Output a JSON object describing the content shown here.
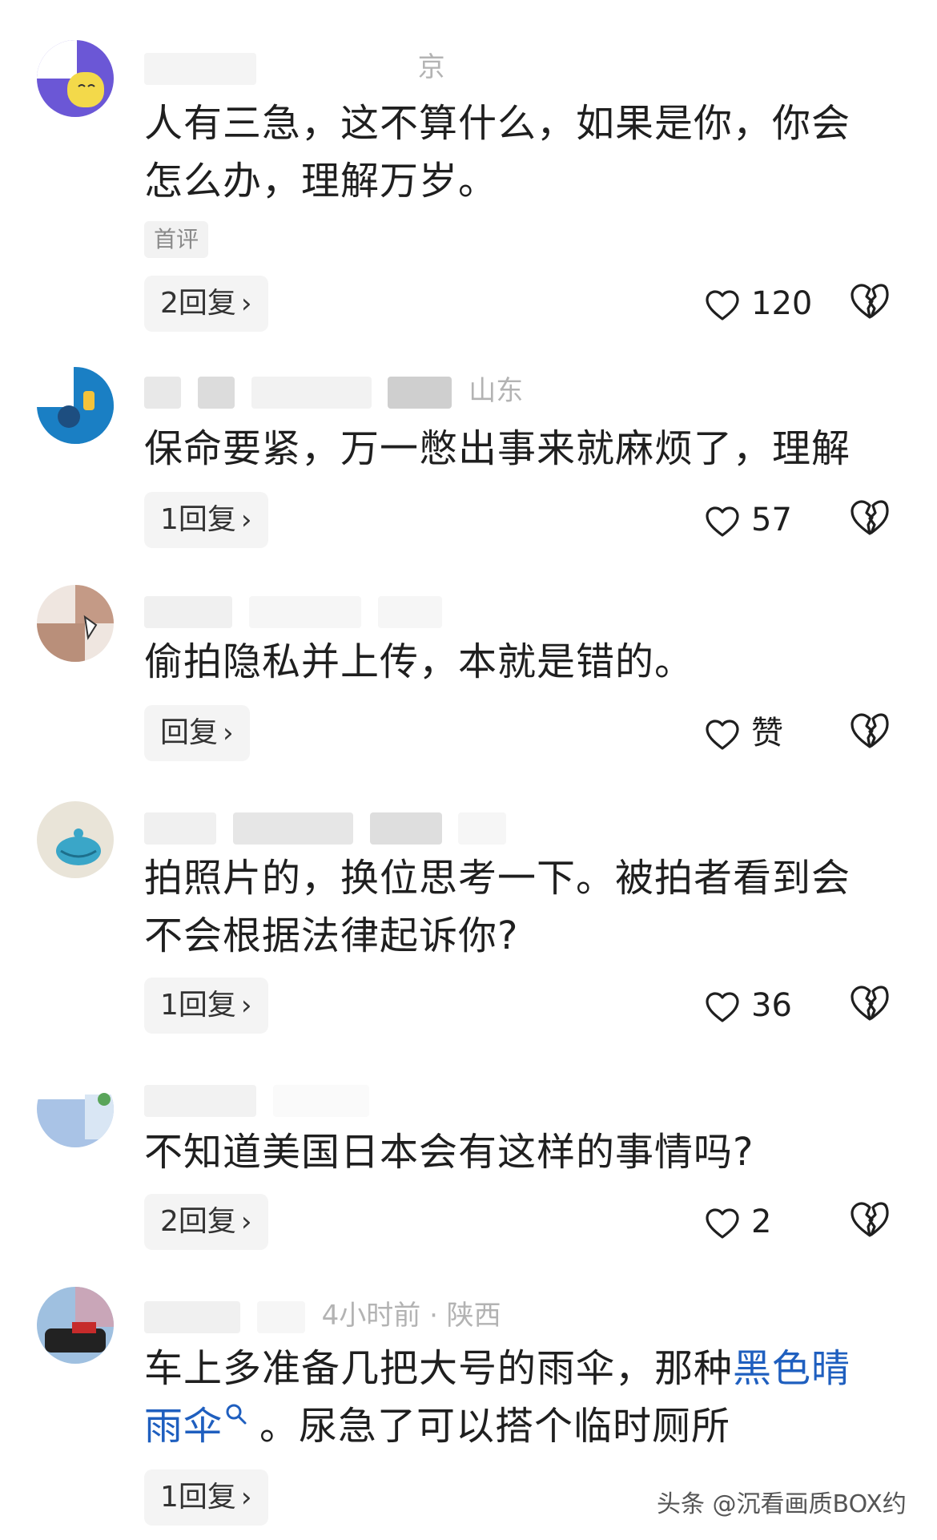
{
  "comments": [
    {
      "meta": "京",
      "text": "人有三急，这不算什么，如果是你，你会怎么办，理解万岁。",
      "tag": "首评",
      "reply": "2回复",
      "likes": "120"
    },
    {
      "meta": "山东",
      "text": "保命要紧，万一憋出事来就麻烦了，理解",
      "reply": "1回复",
      "likes": "57"
    },
    {
      "meta": "",
      "text": "偷拍隐私并上传，本就是错的。",
      "reply": "回复",
      "likes": "赞"
    },
    {
      "meta": "",
      "text": "拍照片的，换位思考一下。被拍者看到会不会根据法律起诉你?",
      "reply": "1回复",
      "likes": "36"
    },
    {
      "meta": "",
      "text": "不知道美国日本会有这样的事情吗?",
      "reply": "2回复",
      "likes": "2"
    },
    {
      "meta": "4小时前 · 陕西",
      "text_before": "车上多准备几把大号的雨伞，那种",
      "link": "黑色晴雨伞",
      "text_after": "。尿急了可以搭个临时厕所",
      "reply": "1回复"
    }
  ],
  "icons": {
    "like": "heart-outline-icon",
    "dislike": "broken-heart-icon",
    "reply_chevron": "chevron-right-icon",
    "search": "search-icon"
  },
  "colors": {
    "link": "#1f5fbf",
    "meta": "#b3b3b3",
    "reply_bg": "#f4f4f4"
  },
  "watermark": "头条 @沉看画质BOX约"
}
